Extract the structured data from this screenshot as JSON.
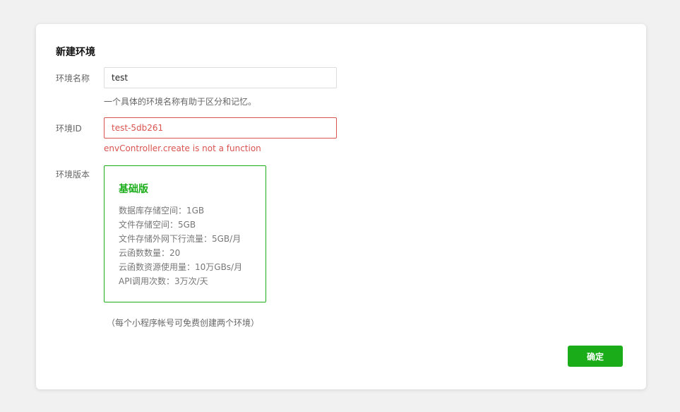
{
  "dialog": {
    "title": "新建环境",
    "env_name": {
      "label": "环境名称",
      "value": "test",
      "hint": "一个具体的环境名称有助于区分和记忆。"
    },
    "env_id": {
      "label": "环境ID",
      "value": "test-5db261",
      "error": "envController.create is not a function"
    },
    "env_version": {
      "label": "环境版本",
      "plan": {
        "name": "基础版",
        "features": [
          "数据库存储空间：1GB",
          "文件存储空间：5GB",
          "文件存储外网下行流量：5GB/月",
          "云函数数量：20",
          "云函数资源使用量：10万GBs/月",
          "API调用次数：3万次/天"
        ]
      },
      "footnote": "（每个小程序帐号可免费创建两个环境）"
    },
    "confirm_label": "确定"
  },
  "colors": {
    "accent": "#1aad19",
    "error": "#d9534f"
  }
}
